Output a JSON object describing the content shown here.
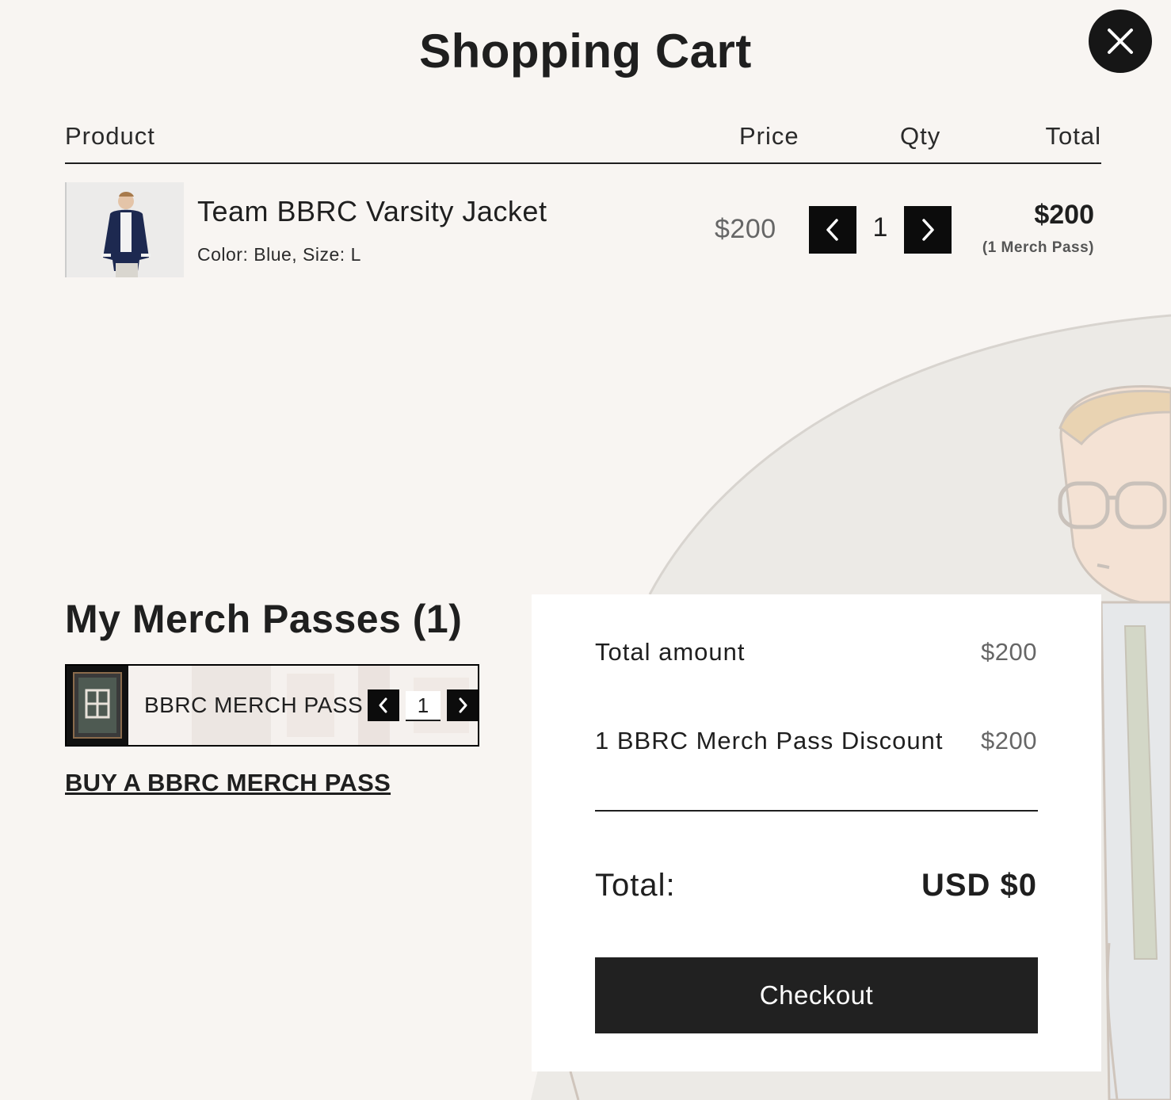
{
  "cart": {
    "title": "Shopping Cart",
    "close_icon": "close-icon",
    "columns": {
      "product": "Product",
      "price": "Price",
      "qty": "Qty",
      "total": "Total"
    },
    "items": [
      {
        "name": "Team BBRC Varsity Jacket",
        "variant": "Color: Blue, Size: L",
        "price": "$200",
        "qty": "1",
        "total": "$200",
        "pass_note": "(1 Merch Pass)"
      }
    ]
  },
  "passes": {
    "title": "My Merch Passes (1)",
    "items": [
      {
        "name": "BBRC MERCH PASS",
        "qty": "1"
      }
    ],
    "buy_link": "BUY A BBRC MERCH PASS"
  },
  "summary": {
    "total_amount_label": "Total amount",
    "total_amount_value": "$200",
    "discount_label": "1 BBRC Merch Pass Discount",
    "discount_value": "$200",
    "total_label": "Total:",
    "total_value": "USD $0",
    "checkout_label": "Checkout"
  },
  "colors": {
    "background": "#f8f5f2",
    "button": "#0c0c0c",
    "checkout": "#212121",
    "summary_panel": "#ffffff"
  }
}
